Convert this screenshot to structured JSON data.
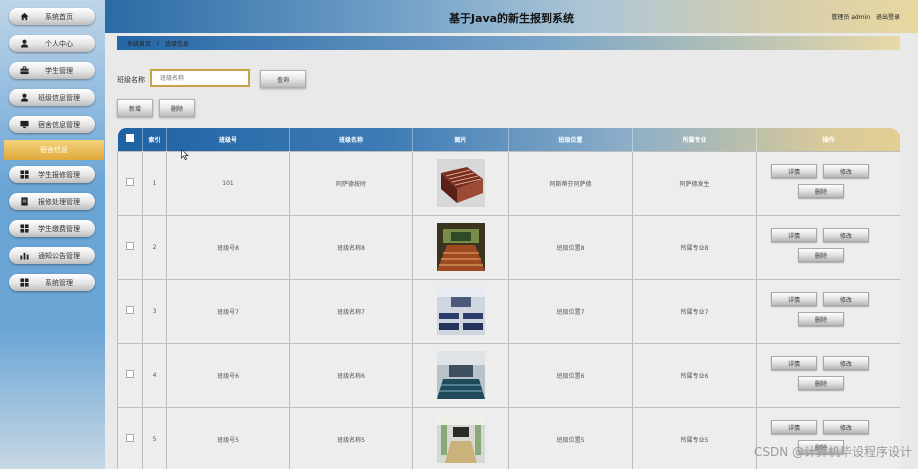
{
  "app": {
    "title": "基于Java的新生报到系统"
  },
  "user": {
    "role_name": "管理员 admin",
    "logout": "退出登录"
  },
  "sidebar": {
    "items": [
      {
        "label": "系统首页",
        "icon": "home-icon"
      },
      {
        "label": "个人中心",
        "icon": "person-icon"
      },
      {
        "label": "学生管理",
        "icon": "briefcase-icon"
      },
      {
        "label": "班级信息管理",
        "icon": "person-icon"
      },
      {
        "label": "宿舍信息管理",
        "icon": "monitor-icon"
      }
    ],
    "active_sub": "宿舍信息",
    "items2": [
      {
        "label": "学生报修管理",
        "icon": "grid-icon"
      },
      {
        "label": "报修处理管理",
        "icon": "document-icon"
      },
      {
        "label": "学生缴费管理",
        "icon": "grid-icon"
      },
      {
        "label": "通知公告管理",
        "icon": "bar-chart-icon"
      },
      {
        "label": "系统管理",
        "icon": "grid-icon"
      }
    ]
  },
  "breadcrumb": {
    "home": "系统首页",
    "separator": "/",
    "current": "班级信息"
  },
  "search": {
    "label": "班级名称",
    "placeholder": "班级名称",
    "button": "查询"
  },
  "actions": {
    "add": "新增",
    "delete": "删除"
  },
  "table": {
    "headers": [
      "",
      "索引",
      "班级号",
      "班级名称",
      "图片",
      "班级位置",
      "所属专业",
      "操作"
    ],
    "rows": [
      {
        "index": "1",
        "class_no": "101",
        "class_name": "阿萨德按时",
        "location": "阿斯蒂芬阿萨德",
        "major": "阿萨德发生"
      },
      {
        "index": "2",
        "class_no": "班级号8",
        "class_name": "班级名称8",
        "location": "班级位置8",
        "major": "所属专业8"
      },
      {
        "index": "3",
        "class_no": "班级号7",
        "class_name": "班级名称7",
        "location": "班级位置7",
        "major": "所属专业7"
      },
      {
        "index": "4",
        "class_no": "班级号6",
        "class_name": "班级名称6",
        "location": "班级位置6",
        "major": "所属专业6"
      },
      {
        "index": "5",
        "class_no": "班级号5",
        "class_name": "班级名称5",
        "location": "班级位置5",
        "major": "所属专业5"
      }
    ],
    "row_actions": {
      "detail": "详情",
      "edit": "修改",
      "delete": "删除"
    }
  },
  "watermark": "CSDN @计算机毕设程序设计"
}
